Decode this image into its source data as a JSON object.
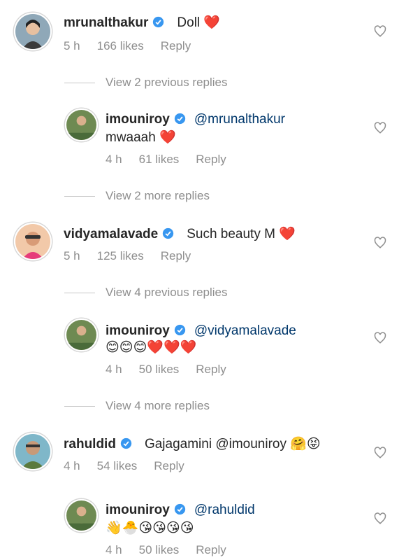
{
  "comments": [
    {
      "username": "mrunalthakur",
      "text": "Doll ❤️",
      "time": "5 h",
      "likes": "166 likes",
      "reply_label": "Reply",
      "thread_link": "View 2 previous replies",
      "reply": {
        "username": "imouniroy",
        "mention": "@mrunalthakur",
        "text": "mwaaah ❤️",
        "time": "4 h",
        "likes": "61 likes",
        "reply_label": "Reply"
      },
      "after_link": "View 2 more replies"
    },
    {
      "username": "vidyamalavade",
      "text": "Such beauty M ❤️",
      "time": "5 h",
      "likes": "125 likes",
      "reply_label": "Reply",
      "thread_link": "View 4 previous replies",
      "reply": {
        "username": "imouniroy",
        "mention": "@vidyamalavade",
        "text": "😊😊😊❤️❤️❤️",
        "time": "4 h",
        "likes": "50 likes",
        "reply_label": "Reply"
      },
      "after_link": "View 4 more replies"
    },
    {
      "username": "rahuldid",
      "text": "Gajagamini @imouniroy 🤗😝",
      "time": "4 h",
      "likes": "54 likes",
      "reply_label": "Reply",
      "reply": {
        "username": "imouniroy",
        "mention": "@rahuldid",
        "text": "👋🐣😘😘😘😘",
        "time": "4 h",
        "likes": "50 likes",
        "reply_label": "Reply"
      }
    }
  ],
  "colors": {
    "verified": "#3897f0",
    "heart": "#ed2d3b",
    "mention": "#00376b",
    "meta": "#8e8e8e"
  },
  "icons": {
    "like": "heart-outline-icon",
    "verified": "verified-badge-icon"
  }
}
